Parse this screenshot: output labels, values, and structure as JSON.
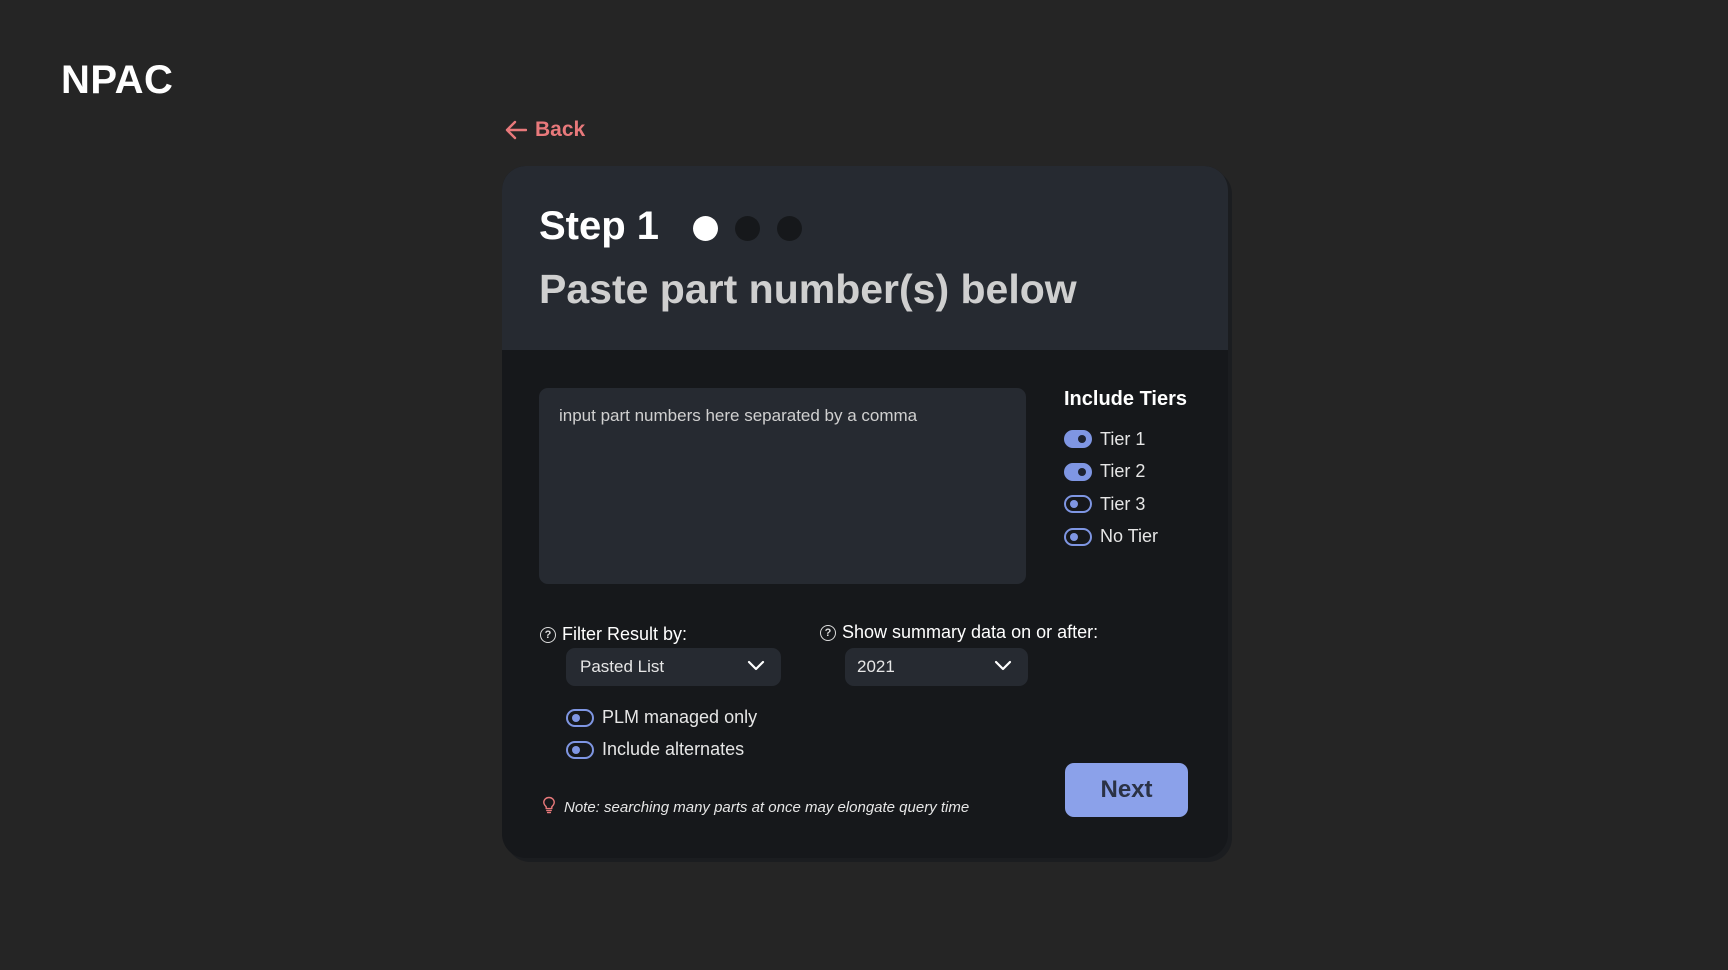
{
  "app": {
    "logo": "NPAC"
  },
  "nav": {
    "back_label": "Back"
  },
  "header": {
    "step_title": "Step 1",
    "steps_total": 3,
    "current_step": 1,
    "subtitle": "Paste part number(s) below"
  },
  "input": {
    "value": "",
    "placeholder": "input part numbers here separated by a comma"
  },
  "tiers": {
    "title": "Include Tiers",
    "items": [
      {
        "label": "Tier 1",
        "enabled": true
      },
      {
        "label": "Tier 2",
        "enabled": true
      },
      {
        "label": "Tier 3",
        "enabled": false
      },
      {
        "label": "No Tier",
        "enabled": false
      }
    ]
  },
  "filter": {
    "label": "Filter Result by:",
    "selected": "Pasted List"
  },
  "summary": {
    "label": "Show summary data on or after:",
    "selected": "2021"
  },
  "options": {
    "plm_label": "PLM managed only",
    "plm_enabled": false,
    "alternates_label": "Include alternates",
    "alternates_enabled": false
  },
  "note": "Note: searching many parts at once may elongate query time",
  "actions": {
    "next_label": "Next"
  },
  "colors": {
    "background": "#252525",
    "card": "#16181b",
    "card_header": "#262a31",
    "accent": "#8ba1ea",
    "back_link": "#e8797b"
  },
  "icons": {
    "back": "arrow-left-icon",
    "help": "question-circle-icon",
    "dropdown": "chevron-down-icon",
    "note": "lightbulb-icon"
  }
}
